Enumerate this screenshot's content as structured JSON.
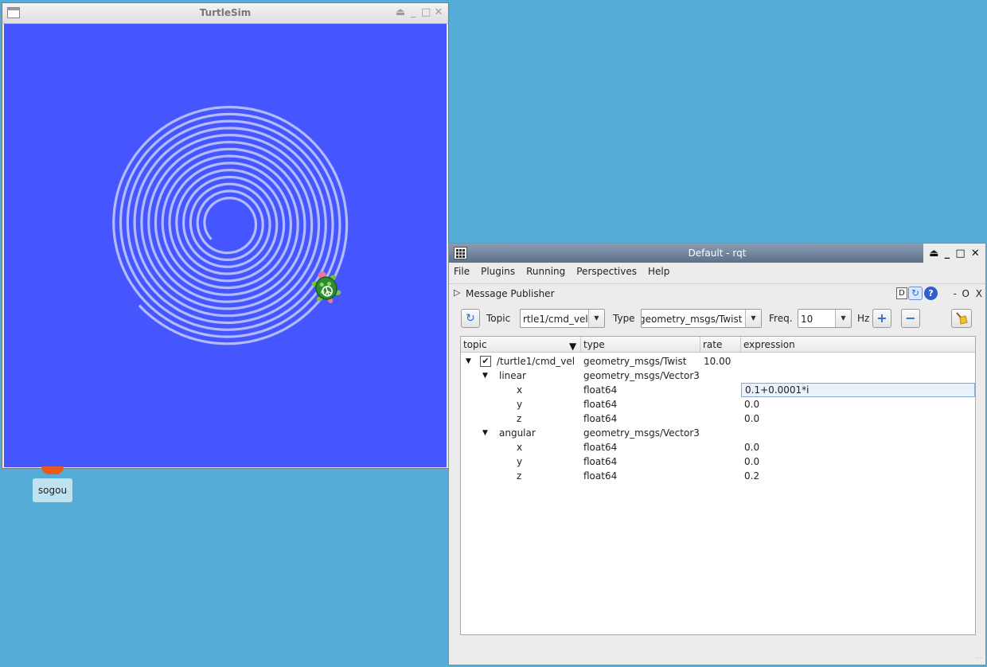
{
  "turtlesim": {
    "title": "TurtleSim",
    "title_buttons": [
      "⏏",
      "_",
      "□",
      "✕"
    ],
    "canvas_color": "#4556ff",
    "trail_color": "#b3baff"
  },
  "desktop": {
    "icon_label": "sogou"
  },
  "rqt": {
    "title": "Default - rqt",
    "title_buttons": [
      "⏏",
      "_",
      "□",
      "✕"
    ],
    "menu": [
      "File",
      "Plugins",
      "Running",
      "Perspectives",
      "Help"
    ],
    "plugin": {
      "arrow": "▷",
      "name": "Message Publisher",
      "d_label": "D",
      "help_label": "?",
      "dash": "-",
      "o": "O",
      "x": "X"
    },
    "toolbar": {
      "topic_label": "Topic",
      "topic_value": "rtle1/cmd_vel",
      "type_label": "Type",
      "type_value": "geometry_msgs/Twist",
      "freq_label": "Freq.",
      "freq_value": "10",
      "hz_label": "Hz",
      "add_label": "+",
      "remove_label": "−"
    },
    "table": {
      "columns": [
        "topic",
        "type",
        "rate",
        "expression"
      ],
      "rows": [
        {
          "topic": "/turtle1/cmd_vel",
          "type": "geometry_msgs/Twist",
          "rate": "10.00",
          "expression": "",
          "checked": "✔"
        },
        {
          "topic": "linear",
          "type": "geometry_msgs/Vector3",
          "rate": "",
          "expression": ""
        },
        {
          "topic": "x",
          "type": "float64",
          "rate": "",
          "expression": "0.1+0.0001*i"
        },
        {
          "topic": "y",
          "type": "float64",
          "rate": "",
          "expression": "0.0"
        },
        {
          "topic": "z",
          "type": "float64",
          "rate": "",
          "expression": "0.0"
        },
        {
          "topic": "angular",
          "type": "geometry_msgs/Vector3",
          "rate": "",
          "expression": ""
        },
        {
          "topic": "x",
          "type": "float64",
          "rate": "",
          "expression": "0.0"
        },
        {
          "topic": "y",
          "type": "float64",
          "rate": "",
          "expression": "0.0"
        },
        {
          "topic": "z",
          "type": "float64",
          "rate": "",
          "expression": "0.2"
        }
      ]
    }
  }
}
